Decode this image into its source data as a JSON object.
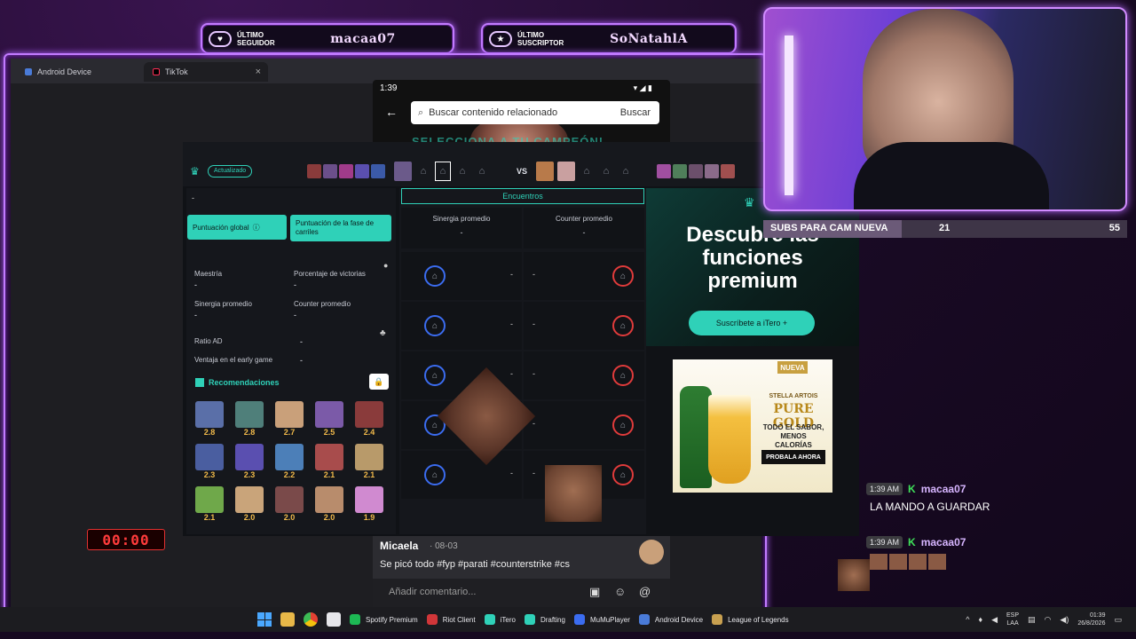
{
  "overlay": {
    "follower_label": "ÚLTIMO SEGUIDOR",
    "follower_name": "macaa07",
    "subscriber_label": "ÚLTIMO SUSCRIPTOR",
    "subscriber_name": "SoNatahlA",
    "subs_goal_label": "SUBS PARA CAM NUEVA",
    "subs_goal_current": "21",
    "subs_goal_target": "55",
    "subs_goal_progress": 0.38,
    "timer": "00:00"
  },
  "desktop": {
    "tabs": [
      {
        "label": "Android Device"
      },
      {
        "label": "TikTok"
      }
    ],
    "close_glyph": "×"
  },
  "phone": {
    "time": "1:39",
    "search_placeholder": "Buscar contenido relacionado",
    "search_button": "Buscar",
    "overlay_text": "SELECCIONA A TU CAMPEÓN!",
    "author": "Micaela",
    "date": "· 08-03",
    "caption": "Se picó todo #fyp #parati #counterstrike #cs",
    "comment_placeholder": "Añadir comentario..."
  },
  "itero": {
    "status_badge": "Actualizado",
    "vs_label": "VS",
    "dash": "-",
    "btn_global": "Puntuación global",
    "btn_lane": "Puntuación de la fase de carriles",
    "stats": [
      {
        "label": "Maestría",
        "value": "-"
      },
      {
        "label": "Porcentaje de victorias",
        "value": "-"
      },
      {
        "label": "Sinergia promedio",
        "value": "-"
      },
      {
        "label": "Counter promedio",
        "value": "-"
      }
    ],
    "extra_stats": [
      {
        "label": "Ratio AD",
        "value": "-"
      },
      {
        "label": "Ventaja en el early game",
        "value": "-"
      }
    ],
    "recommendations_title": "Recomendaciones",
    "recommendations": [
      {
        "score": "2.8",
        "color": "#5a6fa8"
      },
      {
        "score": "2.8",
        "color": "#4f7f7a"
      },
      {
        "score": "2.7",
        "color": "#c9a07a"
      },
      {
        "score": "2.5",
        "color": "#7b5aa8"
      },
      {
        "score": "2.4",
        "color": "#8a3b3b"
      },
      {
        "score": "2.3",
        "color": "#4a5ea0"
      },
      {
        "score": "2.3",
        "color": "#5a4fb0"
      },
      {
        "score": "2.2",
        "color": "#4c7fb8"
      },
      {
        "score": "2.1",
        "color": "#a84c4c"
      },
      {
        "score": "2.1",
        "color": "#b89a6a"
      },
      {
        "score": "2.1",
        "color": "#6fa84a"
      },
      {
        "score": "2.0",
        "color": "#c9a47a"
      },
      {
        "score": "2.0",
        "color": "#7a4a4a"
      },
      {
        "score": "2.0",
        "color": "#b88c6c"
      },
      {
        "score": "1.9",
        "color": "#d08ad0"
      }
    ],
    "encounters_title": "Encuentros",
    "synergy_label": "Sinergia promedio",
    "counter_label": "Counter promedio",
    "encounter_rows": [
      {
        "synergy": "-",
        "counter": "-"
      },
      {
        "synergy": "-",
        "counter": "-"
      },
      {
        "synergy": "-",
        "counter": "-"
      },
      {
        "synergy": "-",
        "counter": "-"
      },
      {
        "synergy": "-",
        "counter": "-"
      }
    ],
    "premium_title": "Descubre las funciones premium",
    "premium_button": "Suscríbete a iTero +",
    "ad": {
      "badge": "NUEVA",
      "brand": "STELLA ARTOIS",
      "product": "PURE GOLD",
      "tagline": "TODO EL SABOR, MENOS CALORÍAS",
      "cta": "PROBALA AHORA"
    }
  },
  "chat": [
    {
      "time": "1:39 AM",
      "user": "macaa07",
      "message": "LA MANDO A GUARDAR"
    },
    {
      "time": "1:39 AM",
      "user": "macaa07",
      "message": ""
    }
  ],
  "taskbar": {
    "apps": [
      {
        "label": "Spotify Premium",
        "color": "#1db954"
      },
      {
        "label": "Riot Client",
        "color": "#d13639"
      },
      {
        "label": "iTero",
        "color": "#2fd1b8"
      },
      {
        "label": "Drafting",
        "color": "#2fd1b8"
      },
      {
        "label": "MuMuPlayer",
        "color": "#3b6cf0"
      },
      {
        "label": "Android Device",
        "color": "#4a7bd8"
      },
      {
        "label": "League of Legends",
        "color": "#c8a050"
      }
    ],
    "lang": "ESP",
    "lang_sub": "LAA",
    "time": "01:39",
    "date": "26/8/2026"
  }
}
